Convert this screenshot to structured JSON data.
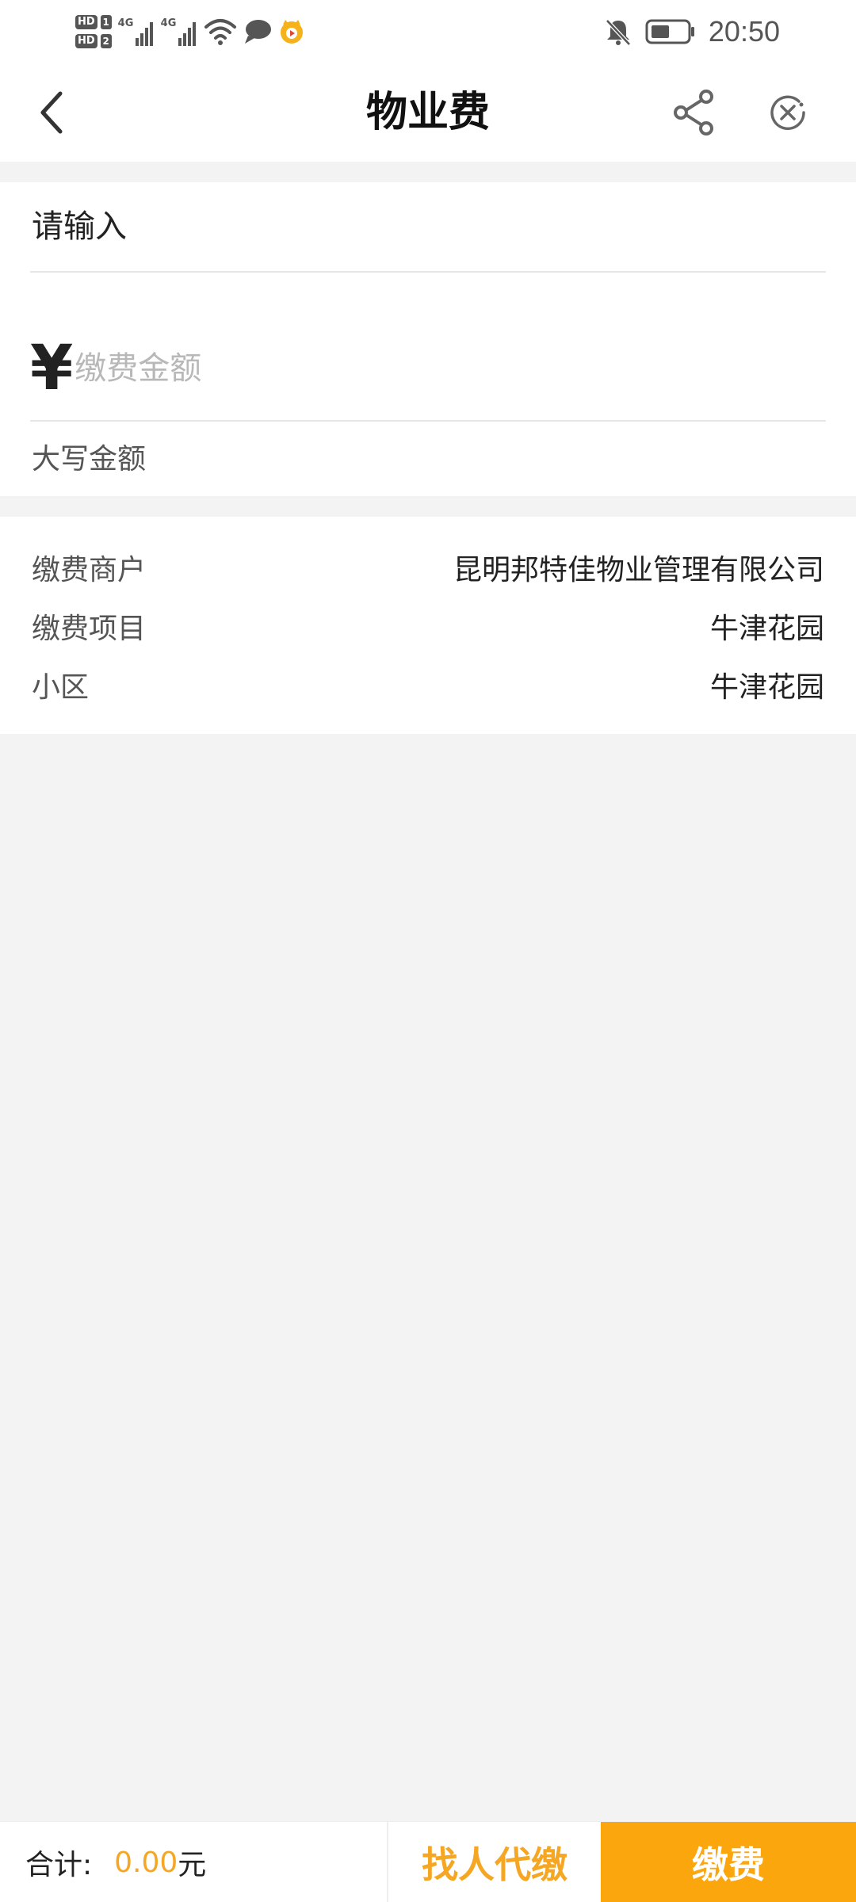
{
  "status_bar": {
    "sim1_badge": "HD",
    "sim1_num": "1",
    "sim2_badge": "HD",
    "sim2_num": "2",
    "network1": "4G",
    "network2": "4G",
    "time": "20:50",
    "icons": [
      "signal-icon",
      "wifi-icon",
      "chat-bubble-icon",
      "app-mascot-icon",
      "bell-muted-icon",
      "battery-icon"
    ]
  },
  "header": {
    "title": "物业费",
    "icons": [
      "back-arrow-icon",
      "share-icon",
      "close-circle-icon"
    ]
  },
  "amount_section": {
    "prompt": "请输入",
    "currency_symbol": "¥",
    "amount_placeholder": "缴费金额",
    "amount_value": "",
    "uppercase_label": "大写金额"
  },
  "info_section": {
    "rows": [
      {
        "label": "缴费商户",
        "value": "昆明邦特佳物业管理有限公司"
      },
      {
        "label": "缴费项目",
        "value": "牛津花园"
      },
      {
        "label": "小区",
        "value": "牛津花园"
      }
    ]
  },
  "footer": {
    "total_label": "合计:",
    "total_amount": "0.00",
    "total_unit": "元",
    "proxy_button": "找人代缴",
    "pay_button": "缴费",
    "colors": {
      "accent": "#f5a623",
      "pay_button_bg": "#fca60e"
    }
  }
}
